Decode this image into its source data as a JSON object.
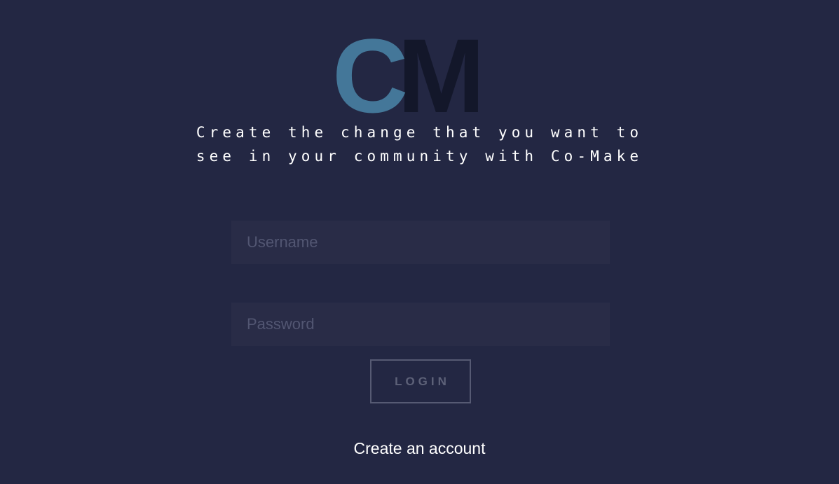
{
  "logo": {
    "letter_c": "C",
    "letter_m": "M",
    "color_c": "#4a86a8",
    "color_m": "#13172a"
  },
  "tagline": {
    "line1": "Create the change that you want to",
    "line2": "see in your community with Co-Make"
  },
  "form": {
    "username_placeholder": "Username",
    "password_placeholder": "Password",
    "login_label": "LOGIN"
  },
  "footer": {
    "create_account": "Create an account"
  },
  "colors": {
    "background": "#232743",
    "field_background": "#292c47",
    "placeholder": "#525672",
    "button_border": "#565a73"
  }
}
